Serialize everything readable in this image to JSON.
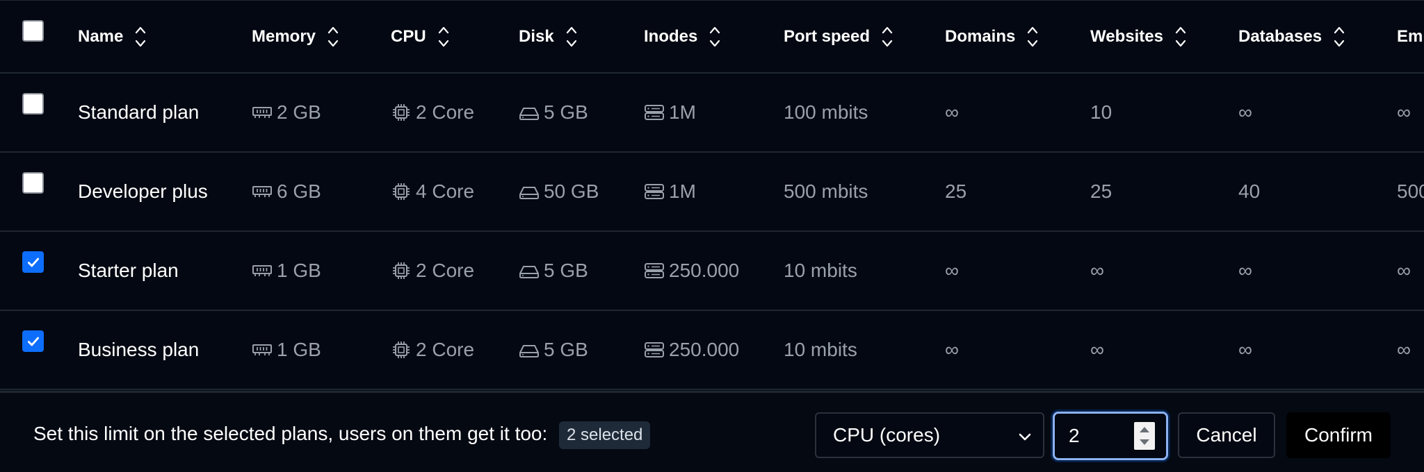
{
  "columns": [
    {
      "key": "name",
      "label": "Name"
    },
    {
      "key": "memory",
      "label": "Memory"
    },
    {
      "key": "cpu",
      "label": "CPU"
    },
    {
      "key": "disk",
      "label": "Disk"
    },
    {
      "key": "inodes",
      "label": "Inodes"
    },
    {
      "key": "port_speed",
      "label": "Port speed"
    },
    {
      "key": "domains",
      "label": "Domains"
    },
    {
      "key": "websites",
      "label": "Websites"
    },
    {
      "key": "databases",
      "label": "Databases"
    },
    {
      "key": "emails",
      "label": "Em"
    }
  ],
  "icons": {
    "sort": "sort-arrows-icon",
    "memory": "memory-icon",
    "cpu": "cpu-icon",
    "disk": "disk-icon",
    "inodes": "server-icon",
    "check": "check-icon",
    "select": "chevron-down-icon"
  },
  "rows": [
    {
      "checked": false,
      "name": "Standard plan",
      "memory": "2 GB",
      "cpu": "2 Core",
      "disk": "5 GB",
      "inodes": "1M",
      "port_speed": "100 mbits",
      "domains": "∞",
      "websites": "10",
      "databases": "∞",
      "emails": "∞"
    },
    {
      "checked": false,
      "name": "Developer plus",
      "memory": "6 GB",
      "cpu": "4 Core",
      "disk": "50 GB",
      "inodes": "1M",
      "port_speed": "500 mbits",
      "domains": "25",
      "websites": "25",
      "databases": "40",
      "emails": "500"
    },
    {
      "checked": true,
      "name": "Starter plan",
      "memory": "1 GB",
      "cpu": "2 Core",
      "disk": "5 GB",
      "inodes": "250.000",
      "port_speed": "10 mbits",
      "domains": "∞",
      "websites": "∞",
      "databases": "∞",
      "emails": "∞"
    },
    {
      "checked": true,
      "name": "Business plan",
      "memory": "1 GB",
      "cpu": "2 Core",
      "disk": "5 GB",
      "inodes": "250.000",
      "port_speed": "10 mbits",
      "domains": "∞",
      "websites": "∞",
      "databases": "∞",
      "emails": "∞"
    }
  ],
  "header_checkbox_checked": false,
  "footer": {
    "label": "Set this limit on the selected plans, users on them get it too:",
    "selected_badge": "2 selected",
    "limit_select": {
      "selected": "CPU (cores)"
    },
    "limit_value": "2",
    "cancel_label": "Cancel",
    "confirm_label": "Confirm"
  },
  "colors": {
    "background": "#040812",
    "accent": "#0d6efd",
    "muted_text": "#9aa1ab",
    "border": "#1f2733"
  }
}
